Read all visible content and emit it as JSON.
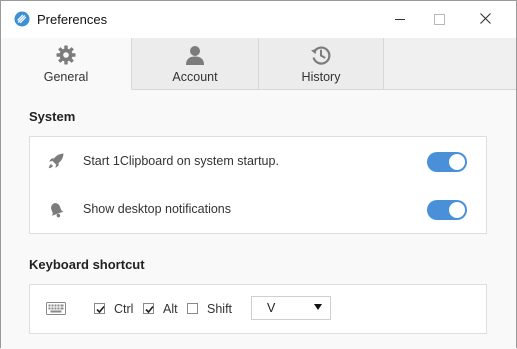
{
  "window": {
    "title": "Preferences",
    "controls": {
      "minimize": "minimize",
      "maximize": "maximize",
      "close": "close"
    }
  },
  "tabs": [
    {
      "label": "General",
      "icon": "gear-icon",
      "active": true
    },
    {
      "label": "Account",
      "icon": "user-icon",
      "active": false
    },
    {
      "label": "History",
      "icon": "history-icon",
      "active": false
    }
  ],
  "system": {
    "title": "System",
    "rows": [
      {
        "label": "Start 1Clipboard on system startup.",
        "icon": "rocket-icon",
        "enabled": true
      },
      {
        "label": "Show desktop notifications",
        "icon": "bell-icon",
        "enabled": true
      }
    ]
  },
  "keyboard": {
    "title": "Keyboard shortcut",
    "icon": "keyboard-icon",
    "modifiers": [
      {
        "label": "Ctrl",
        "checked": true
      },
      {
        "label": "Alt",
        "checked": true
      },
      {
        "label": "Shift",
        "checked": false
      }
    ],
    "key": "V"
  },
  "colors": {
    "accent": "#4a90d9",
    "window_bg": "#f9f9f9",
    "card_bg": "#ffffff"
  }
}
